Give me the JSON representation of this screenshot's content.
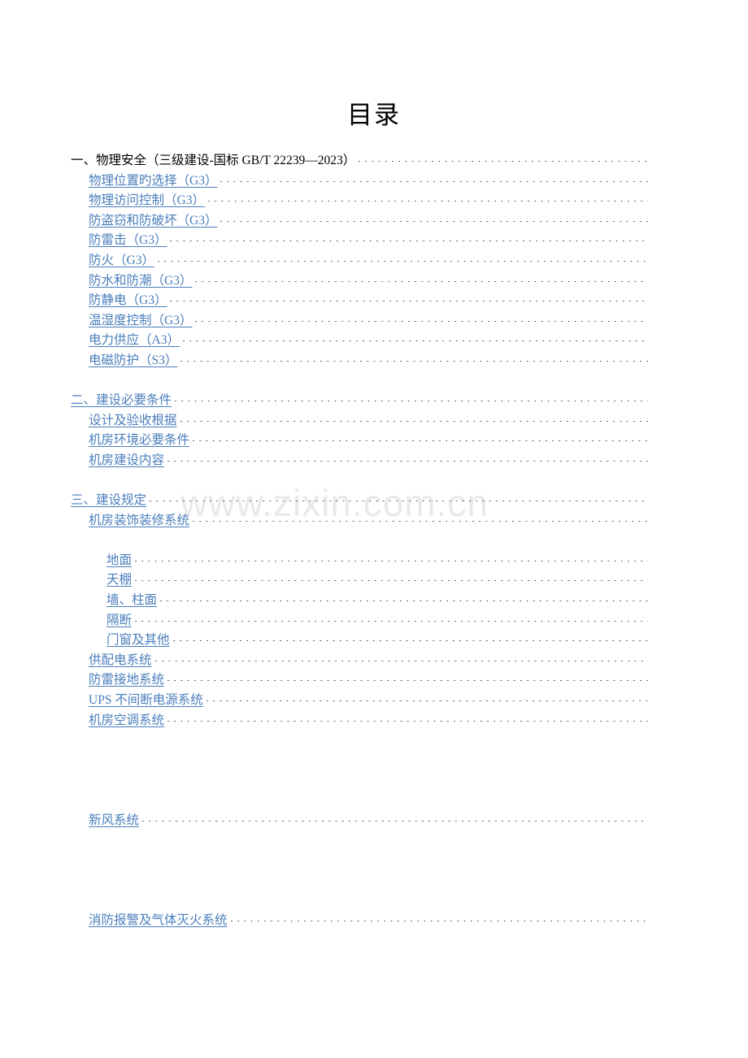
{
  "document": {
    "title": "目录",
    "watermark": "www.zixin.com.cn"
  },
  "toc": {
    "entries": [
      {
        "level": "lvl0",
        "label": "一、物理安全（三级建设-国标 GB/T  22239—2023）"
      },
      {
        "level": "lvl1",
        "label": "物理位置旳选择（G3）"
      },
      {
        "level": "lvl1",
        "label": "物理访问控制（G3）"
      },
      {
        "level": "lvl1",
        "label": "防盗窃和防破坏（G3）"
      },
      {
        "level": "lvl1",
        "label": "防雷击（G3）"
      },
      {
        "level": "lvl1",
        "label": "防火（G3）"
      },
      {
        "level": "lvl1",
        "label": "防水和防潮（G3）"
      },
      {
        "level": "lvl1",
        "label": "防静电（G3）"
      },
      {
        "level": "lvl1",
        "label": "温湿度控制（G3）"
      },
      {
        "level": "lvl1",
        "label": "电力供应（A3）"
      },
      {
        "level": "lvl1",
        "label": "电磁防护（S3）"
      },
      {
        "level": "lvl0link",
        "label": "二、建设必要条件"
      },
      {
        "level": "lvl1",
        "label": "设计及验收根据"
      },
      {
        "level": "lvl1",
        "label": "机房环境必要条件"
      },
      {
        "level": "lvl1",
        "label": "机房建设内容"
      },
      {
        "level": "lvl0link",
        "label": "三、建设规定"
      },
      {
        "level": "lvl1",
        "label": "机房装饰装修系统"
      },
      {
        "level": "cont",
        "label": ""
      },
      {
        "level": "lvl2",
        "label": "地面"
      },
      {
        "level": "lvl2",
        "label": "天棚"
      },
      {
        "level": "lvl2",
        "label": "墙、柱面"
      },
      {
        "level": "lvl2",
        "label": "隔断"
      },
      {
        "level": "lvl2",
        "label": "门窗及其他"
      },
      {
        "level": "lvl1",
        "label": "供配电系统"
      },
      {
        "level": "lvl1",
        "label": "防雷接地系统"
      },
      {
        "level": "lvl1",
        "label": " UPS 不间断电源系统"
      },
      {
        "level": "lvl1",
        "label": "机房空调系统"
      },
      {
        "level": "cont",
        "label": ""
      },
      {
        "level": "cont",
        "label": ""
      },
      {
        "level": "cont",
        "label": ""
      },
      {
        "level": "cont",
        "label": ""
      },
      {
        "level": "lvl1",
        "label": "新风系统"
      },
      {
        "level": "cont",
        "label": ""
      },
      {
        "level": "cont",
        "label": ""
      },
      {
        "level": "cont",
        "label": ""
      },
      {
        "level": "cont",
        "label": ""
      },
      {
        "level": "lvl1",
        "label": "消防报警及气体灭火系统"
      },
      {
        "level": "cont",
        "label": ""
      },
      {
        "level": "cont",
        "label": ""
      }
    ]
  },
  "colors": {
    "link": "#4a7ebb",
    "text": "#000000",
    "leader_dot": "#3f3f3f",
    "watermark": "#e9e9e9",
    "page_background": "#ffffff"
  }
}
